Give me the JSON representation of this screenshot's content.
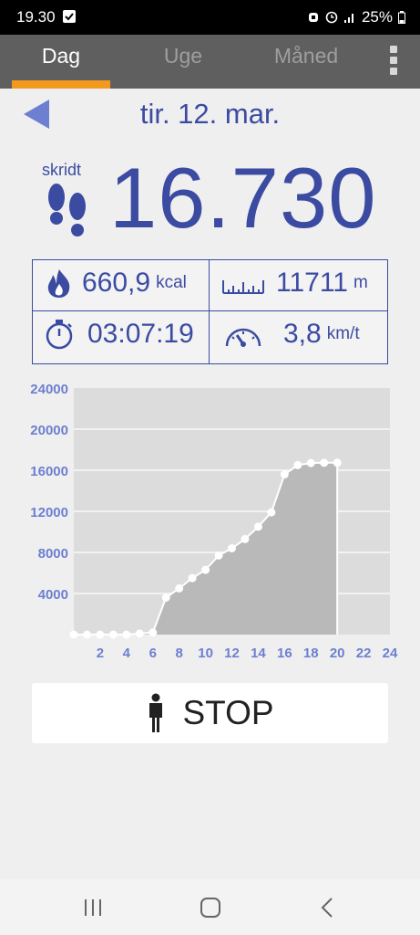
{
  "status_bar": {
    "time": "19.30",
    "battery": "25%"
  },
  "tabs": [
    {
      "label": "Dag",
      "active": true
    },
    {
      "label": "Uge",
      "active": false
    },
    {
      "label": "Måned",
      "active": false
    }
  ],
  "header": {
    "date": "tir. 12. mar."
  },
  "steps": {
    "label": "skridt",
    "value": "16.730"
  },
  "stats": {
    "kcal": {
      "value": "660,9",
      "unit": "kcal"
    },
    "distance": {
      "value": "11711",
      "unit": "m"
    },
    "duration": {
      "value": "03:07:19"
    },
    "speed": {
      "value": "3,8",
      "unit": "km/t"
    }
  },
  "stop_button": {
    "label": "STOP"
  },
  "colors": {
    "accent": "#3b4ba2",
    "tab_indicator": "#f39a1e",
    "tabbar_bg": "#5f5f5f"
  },
  "chart_data": {
    "type": "area",
    "x": [
      0,
      1,
      2,
      3,
      4,
      5,
      6,
      7,
      8,
      9,
      10,
      11,
      12,
      13,
      14,
      15,
      16,
      17,
      18,
      19,
      20
    ],
    "values": [
      0,
      0,
      0,
      0,
      0,
      100,
      200,
      3600,
      4500,
      5500,
      6300,
      7700,
      8400,
      9300,
      10500,
      11900,
      15600,
      16500,
      16700,
      16730,
      16730
    ],
    "xticks": [
      "2",
      "4",
      "6",
      "8",
      "10",
      "12",
      "14",
      "16",
      "18",
      "20",
      "22",
      "24"
    ],
    "yticks": [
      "4000",
      "8000",
      "12000",
      "16000",
      "20000",
      "24000"
    ],
    "xlim": [
      0,
      24
    ],
    "ylim": [
      0,
      24000
    ],
    "current_hour": 20,
    "grid": true
  }
}
